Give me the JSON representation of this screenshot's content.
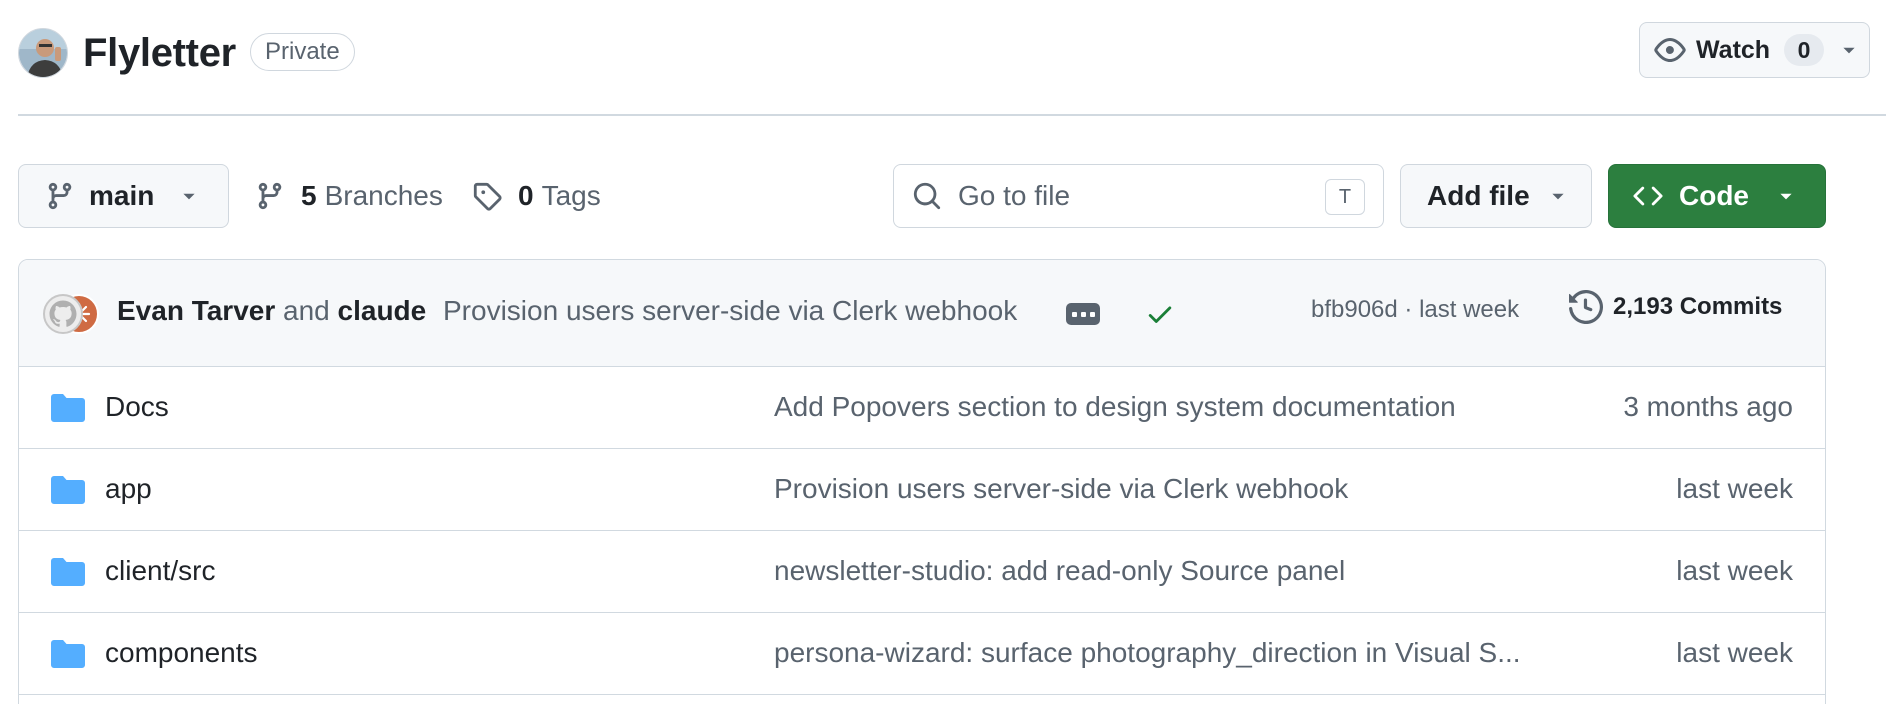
{
  "repo": {
    "name": "Flyletter",
    "visibility": "Private"
  },
  "watch": {
    "label": "Watch",
    "count": "0"
  },
  "toolbar": {
    "branch": "main",
    "branches_count": "5",
    "branches_label": "Branches",
    "tags_count": "0",
    "tags_label": "Tags",
    "search_placeholder": "Go to file",
    "search_shortcut": "T",
    "add_file_label": "Add file",
    "code_label": "Code"
  },
  "latest_commit": {
    "author1": "Evan Tarver",
    "conjunction": "and",
    "author2": "claude",
    "message": "Provision users server-side via Clerk webhook",
    "status": "success",
    "hash_and_time": "bfb906d · last week",
    "commits_label": "2,193 Commits"
  },
  "files": [
    {
      "name": "Docs",
      "type": "folder",
      "message": "Add Popovers section to design system documentation",
      "date": "3 months ago"
    },
    {
      "name": "app",
      "type": "folder",
      "message": "Provision users server-side via Clerk webhook",
      "date": "last week"
    },
    {
      "name": "client/src",
      "type": "folder",
      "message": "newsletter-studio: add read-only Source panel",
      "date": "last week"
    },
    {
      "name": "components",
      "type": "folder",
      "message": "persona-wizard: surface photography_direction in Visual S...",
      "date": "last week"
    }
  ],
  "colors": {
    "accent_green": "#2c7f3f",
    "folder_blue": "#54aeff",
    "check_green": "#1a7f37",
    "border": "#d1d9e0",
    "muted_text": "#59636e"
  }
}
